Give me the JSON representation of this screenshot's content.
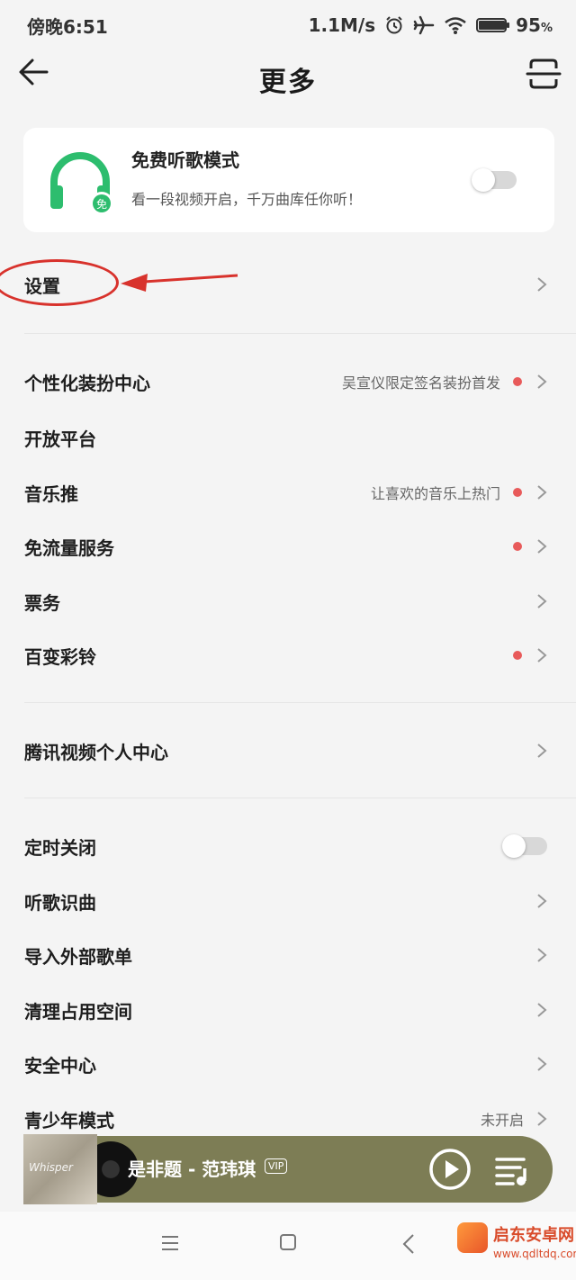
{
  "status_bar": {
    "time": "傍晚6:51",
    "speed": "1.1M/s",
    "alarm_icon": "alarm-icon",
    "airplane_icon": "airplane-icon",
    "wifi_icon": "wifi-icon",
    "battery_level": 0.95,
    "battery_num": "95",
    "battery_unit": "%"
  },
  "header": {
    "title": "更多",
    "back_icon": "back-arrow-icon",
    "scan_icon": "scan-icon"
  },
  "free_mode": {
    "title": "免费听歌模式",
    "description": "看一段视频开启，千万曲库任你听！",
    "badge": "免",
    "toggle_on": false,
    "accent": "#2dbd6e"
  },
  "settings_row": {
    "label": "设置"
  },
  "group1": [
    {
      "label": "个性化装扮中心",
      "sub": "吴宣仪限定签名装扮首发",
      "dot": true,
      "chevron": true
    },
    {
      "label": "开放平台",
      "sub": "",
      "dot": false,
      "chevron": false
    },
    {
      "label": "音乐推",
      "sub": "让喜欢的音乐上热门",
      "dot": true,
      "chevron": true
    },
    {
      "label": "免流量服务",
      "sub": "",
      "dot": true,
      "chevron": true
    },
    {
      "label": "票务",
      "sub": "",
      "dot": false,
      "chevron": true
    },
    {
      "label": "百变彩铃",
      "sub": "",
      "dot": true,
      "chevron": true
    }
  ],
  "group2": [
    {
      "label": "腾讯视频个人中心"
    }
  ],
  "group3": {
    "timer": {
      "label": "定时关闭",
      "toggle_on": false
    },
    "items": [
      {
        "label": "听歌识曲",
        "sub": ""
      },
      {
        "label": "导入外部歌单",
        "sub": ""
      },
      {
        "label": "清理占用空间",
        "sub": ""
      },
      {
        "label": "安全中心",
        "sub": ""
      },
      {
        "label": "青少年模式",
        "sub": "未开启"
      }
    ]
  },
  "player": {
    "song": "是非题 - 范玮琪",
    "vip": "VIP",
    "cover_text": "Whisper",
    "play_icon": "play-icon",
    "playlist_icon": "playlist-icon",
    "bg_color": "#7d7d55"
  },
  "nav": {
    "menu_icon": "menu-icon",
    "home_icon": "home-icon",
    "back_icon": "nav-back-icon"
  },
  "watermark": {
    "title": "启东安卓网",
    "url": "www.qdltdq.com"
  },
  "colors": {
    "red_dot": "#e85a5a",
    "annotation": "#d8322c"
  }
}
